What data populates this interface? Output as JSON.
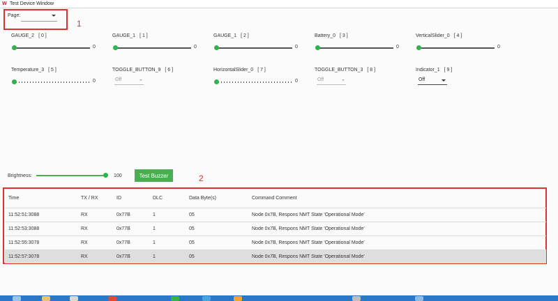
{
  "window": {
    "title": "Test Device Window"
  },
  "annotations": {
    "box1": "1",
    "box2": "2"
  },
  "page_selector": {
    "label": "Page:",
    "value": ""
  },
  "controls": [
    {
      "name": "GAUGE_2",
      "index": "[ 0 ]",
      "kind": "slider",
      "value": "0"
    },
    {
      "name": "GAUGE_1",
      "index": "[ 1 ]",
      "kind": "slider",
      "value": "0"
    },
    {
      "name": "GAUGE_1",
      "index": "[ 2 ]",
      "kind": "slider",
      "value": "0"
    },
    {
      "name": "Battery_0",
      "index": "[ 3 ]",
      "kind": "slider",
      "value": "0"
    },
    {
      "name": "VerticalSlider_0",
      "index": "[ 4 ]",
      "kind": "slider",
      "value": "0"
    },
    {
      "name": "Temperature_3",
      "index": "[ 5 ]",
      "kind": "slider",
      "value": "0"
    },
    {
      "name": "TOGGLE_BUTTON_9",
      "index": "[ 6 ]",
      "kind": "dropdown",
      "value": "Off"
    },
    {
      "name": "HorizontalSlider_0",
      "index": "[ 7 ]",
      "kind": "slider",
      "value": "0"
    },
    {
      "name": "TOGGLE_BUTTON_3",
      "index": "[ 8 ]",
      "kind": "dropdown",
      "value": "Off"
    },
    {
      "name": "Indicator_1",
      "index": "[ 9 ]",
      "kind": "dropdown",
      "value": "Off"
    }
  ],
  "brightness": {
    "label": "Brightness:",
    "value": "100",
    "level_fraction": 1.0
  },
  "buzzer_button": "Test Buzzer",
  "table": {
    "headers": [
      "Time",
      "TX / RX",
      "ID",
      "DLC",
      "Data Byte(s)",
      "Command Comment"
    ],
    "rows": [
      [
        "11:52:51:3088",
        "RX",
        "0x77B",
        "1",
        "05",
        "Node 0x7B, Respons NMT State 'Operational Mode'"
      ],
      [
        "11:52:53:3088",
        "RX",
        "0x77B",
        "1",
        "05",
        "Node 0x7B, Respons NMT State 'Operational Mode'"
      ],
      [
        "11:52:55:3078",
        "RX",
        "0x77B",
        "1",
        "05",
        "Node 0x7B, Respons NMT State 'Operational Mode'"
      ],
      [
        "11:52:57:3078",
        "RX",
        "0x77B",
        "1",
        "05",
        "Node 0x7B, Respons NMT State 'Operational Mode'"
      ]
    ],
    "selected_row": 3
  },
  "colors": {
    "accent_green": "#49b04f",
    "annotation_red": "#e03030",
    "taskbar_blue": "#2a77c7"
  }
}
